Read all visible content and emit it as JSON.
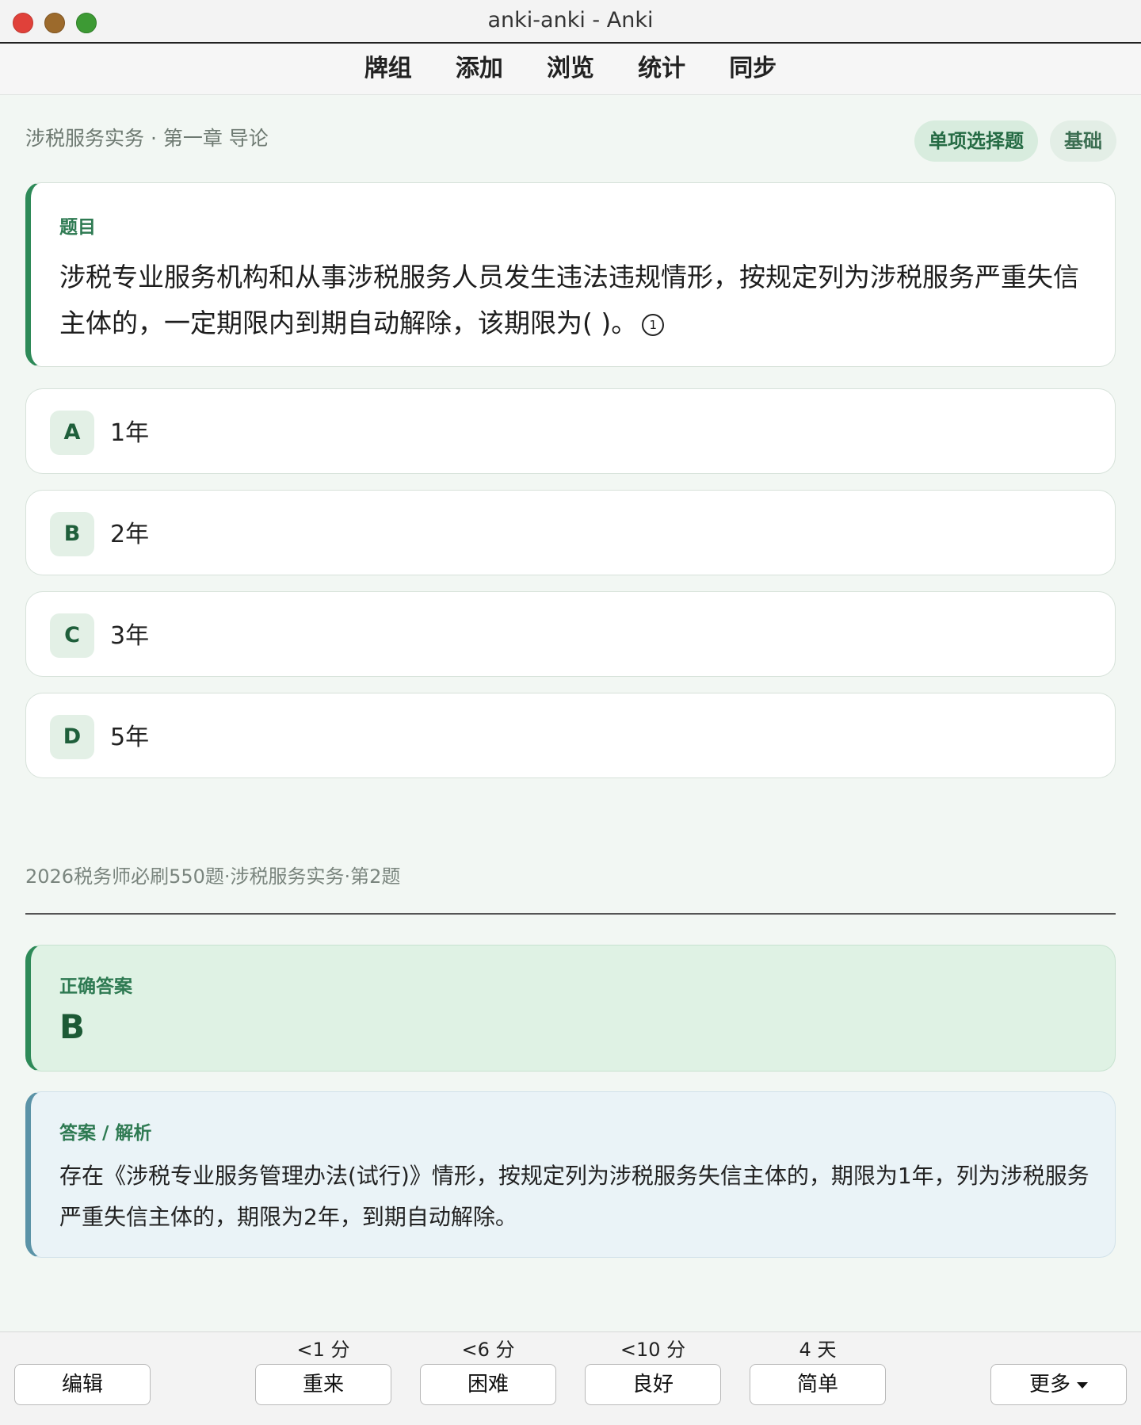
{
  "window": {
    "title": "anki-anki - Anki"
  },
  "toolbar": {
    "decks": "牌组",
    "add": "添加",
    "browse": "浏览",
    "stats": "统计",
    "sync": "同步"
  },
  "card": {
    "breadcrumb": "涉税服务实务 · 第一章 导论",
    "tags": {
      "type": "单项选择题",
      "level": "基础"
    },
    "question_label": "题目",
    "question_text": "涉税专业服务机构和从事涉税服务人员发生违法违规情形，按规定列为涉税服务严重失信主体的，一定期限内到期自动解除，该期限为( )。",
    "note_marker": "1",
    "options": [
      {
        "letter": "A",
        "text": "1年"
      },
      {
        "letter": "B",
        "text": "2年"
      },
      {
        "letter": "C",
        "text": "3年"
      },
      {
        "letter": "D",
        "text": "5年"
      }
    ],
    "source": "2026税务师必刷550题·涉税服务实务·第2题",
    "answer_label": "正确答案",
    "answer_value": "B",
    "explain_label": "答案 / 解析",
    "explain_text": "存在《涉税专业服务管理办法(试行)》情形，按规定列为涉税服务失信主体的，期限为1年，列为涉税服务严重失信主体的，期限为2年，到期自动解除。"
  },
  "bottom": {
    "edit": "编辑",
    "answers": [
      {
        "label": "重来",
        "interval": "<1 分"
      },
      {
        "label": "困难",
        "interval": "<6 分"
      },
      {
        "label": "良好",
        "interval": "<10 分"
      },
      {
        "label": "简单",
        "interval": "4 天"
      }
    ],
    "more": "更多"
  }
}
